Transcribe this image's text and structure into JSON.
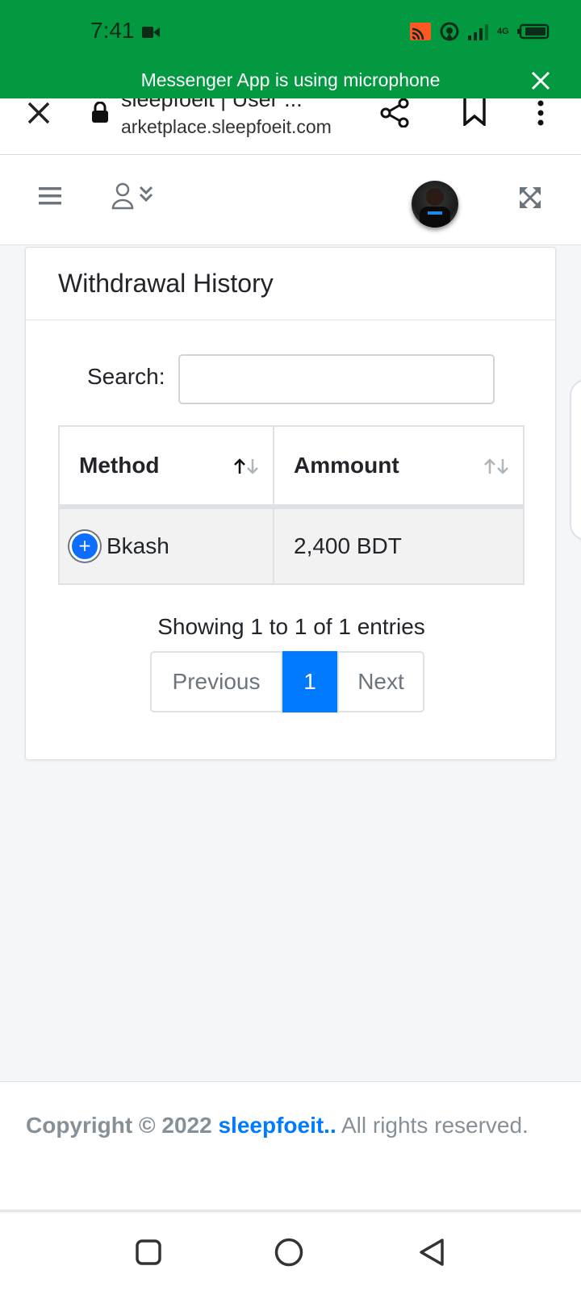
{
  "status_bar": {
    "time": "7:41",
    "network": "4G"
  },
  "notification_banner": {
    "text": "Messenger App is using microphone"
  },
  "browser": {
    "title": "sleepfoeit | User ...",
    "url": "arketplace.sleepfoeit.com"
  },
  "card": {
    "title": "Withdrawal History",
    "search_label": "Search:",
    "search_value": "",
    "table": {
      "columns": [
        "Method",
        "Ammount"
      ],
      "rows": [
        {
          "method": "Bkash",
          "amount": "2,400 BDT"
        }
      ]
    },
    "info": "Showing 1 to 1 of 1 entries",
    "pagination": {
      "previous": "Previous",
      "current": "1",
      "next": "Next"
    }
  },
  "footer": {
    "copyright": "Copyright © 2022",
    "site": "sleepfoeit..",
    "rights": "All rights reserved."
  },
  "colors": {
    "status_green": "#039941",
    "primary_blue": "#007bff",
    "footer_text": "#869099"
  }
}
